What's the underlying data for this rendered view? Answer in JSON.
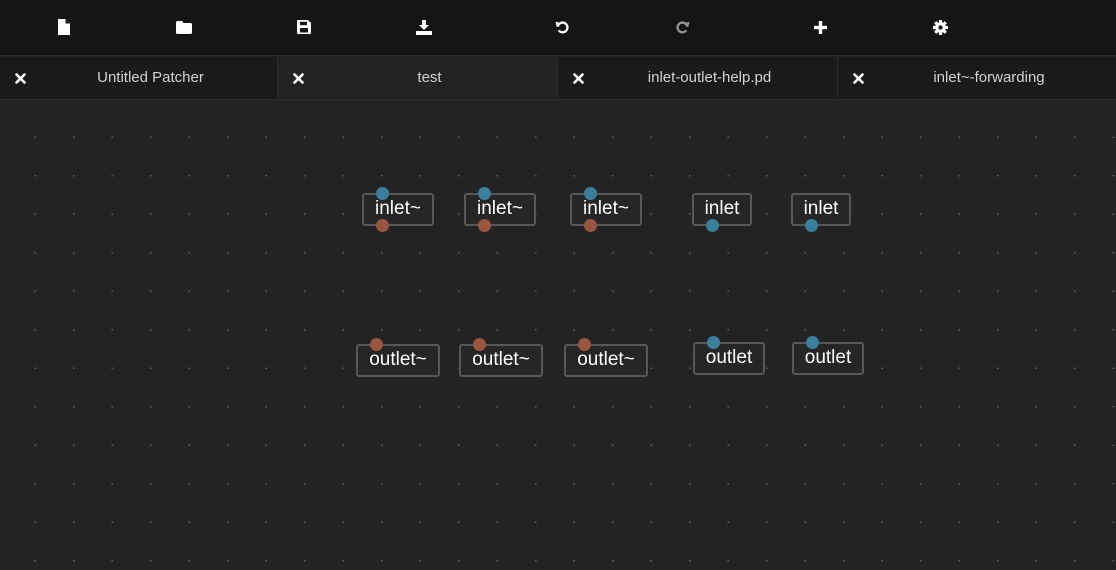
{
  "toolbar": {
    "buttons": [
      {
        "name": "new-file-button",
        "icon": "file-icon"
      },
      {
        "name": "open-folder-button",
        "icon": "folder-icon"
      },
      {
        "name": "save-button",
        "icon": "save-icon"
      },
      {
        "name": "download-button",
        "icon": "download-icon"
      },
      {
        "name": "undo-button",
        "icon": "undo-icon"
      },
      {
        "name": "redo-button",
        "icon": "redo-icon",
        "disabled": true
      },
      {
        "name": "add-object-button",
        "icon": "plus-icon"
      },
      {
        "name": "settings-button",
        "icon": "gear-icon"
      }
    ]
  },
  "tabs": [
    {
      "label": "Untitled Patcher",
      "active": false
    },
    {
      "label": "test",
      "active": true
    },
    {
      "label": "inlet-outlet-help.pd",
      "active": false
    },
    {
      "label": "inlet~-forwarding",
      "active": false
    }
  ],
  "objects": {
    "row1": [
      {
        "text": "inlet~",
        "kind": "signal"
      },
      {
        "text": "inlet~",
        "kind": "signal"
      },
      {
        "text": "inlet~",
        "kind": "signal"
      },
      {
        "text": "inlet",
        "kind": "control"
      },
      {
        "text": "inlet",
        "kind": "control"
      }
    ],
    "row2": [
      {
        "text": "outlet~",
        "kind": "signal"
      },
      {
        "text": "outlet~",
        "kind": "signal"
      },
      {
        "text": "outlet~",
        "kind": "signal"
      },
      {
        "text": "outlet",
        "kind": "control"
      },
      {
        "text": "outlet",
        "kind": "control"
      }
    ]
  },
  "colors": {
    "signal_port": "#9a553e",
    "control_port": "#3b7f9c",
    "toolbar_bg": "#151515",
    "canvas_bg": "#232323"
  }
}
